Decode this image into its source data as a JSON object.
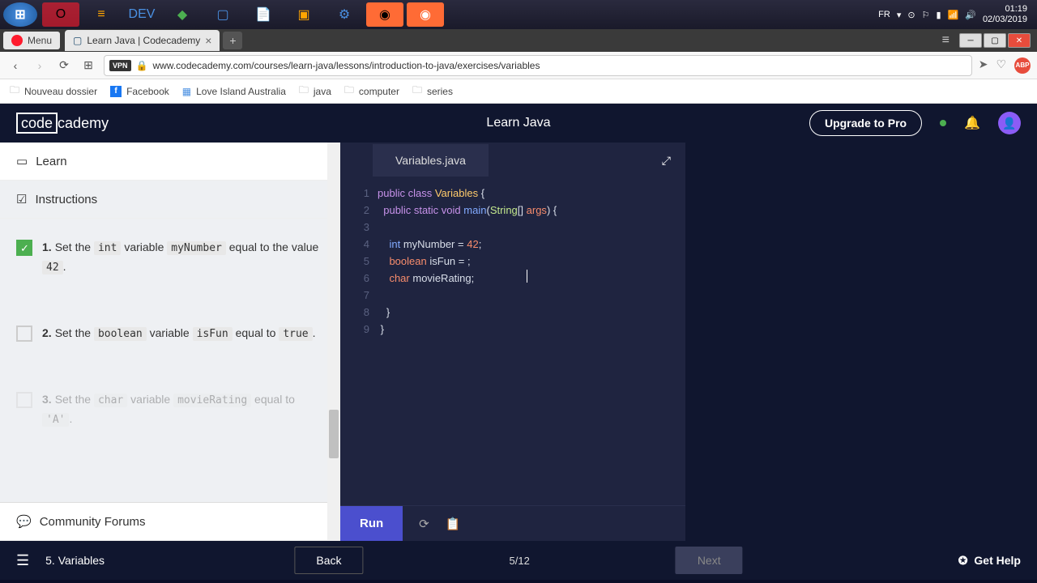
{
  "taskbar": {
    "lang": "FR",
    "time": "01:19",
    "date": "02/03/2019"
  },
  "browser": {
    "menu": "Menu",
    "tab_title": "Learn Java | Codecademy",
    "url": "www.codecademy.com/courses/learn-java/lessons/introduction-to-java/exercises/variables",
    "vpn": "VPN"
  },
  "bookmarks": {
    "b1": "Nouveau dossier",
    "b2": "Facebook",
    "b3": "Love Island Australia",
    "b4": "java",
    "b5": "computer",
    "b6": "series"
  },
  "cc": {
    "logo1": "code",
    "logo2": "cademy",
    "title": "Learn Java",
    "upgrade": "Upgrade to Pro"
  },
  "left": {
    "learn": "Learn",
    "instructions": "Instructions",
    "forums": "Community Forums",
    "i1_a": "Set the ",
    "i1_c1": "int",
    "i1_b": " variable ",
    "i1_c2": "myNumber",
    "i1_c": " equal to the value ",
    "i1_c3": "42",
    "i1_d": ".",
    "i2_a": "Set the ",
    "i2_c1": "boolean",
    "i2_b": " variable ",
    "i2_c2": "isFun",
    "i2_c": " equal to ",
    "i2_c3": "true",
    "i2_d": ".",
    "i3_a": "Set the ",
    "i3_c1": "char",
    "i3_b": " variable ",
    "i3_c2": "movieRating",
    "i3_c": " equal to ",
    "i3_c3": "'A'",
    "i3_d": "."
  },
  "editor": {
    "tab": "Variables.java",
    "l1": "1",
    "l2": "2",
    "l3": "3",
    "l4": "4",
    "l5": "5",
    "l6": "6",
    "l7": "7",
    "l8": "8",
    "l9": "9",
    "run": "Run"
  },
  "code": {
    "public": "public",
    "class": "class",
    "Variables": "Variables",
    "ob": "{",
    "static": "static",
    "void": "void",
    "main": "main",
    "op": "(",
    "String": "String",
    "br": "[]",
    "args": "args",
    "cp": ")",
    "int": "int",
    "myNumber": "myNumber",
    "eq": " = ",
    "n42": "42",
    "sc": ";",
    "boolean": "boolean",
    "isFun": "isFun",
    "char": "char",
    "movieRating": "movieRating",
    "cb": "}"
  },
  "nav": {
    "lesson": "5. Variables",
    "back": "Back",
    "progress": "5/12",
    "next": "Next",
    "help": "Get Help"
  }
}
